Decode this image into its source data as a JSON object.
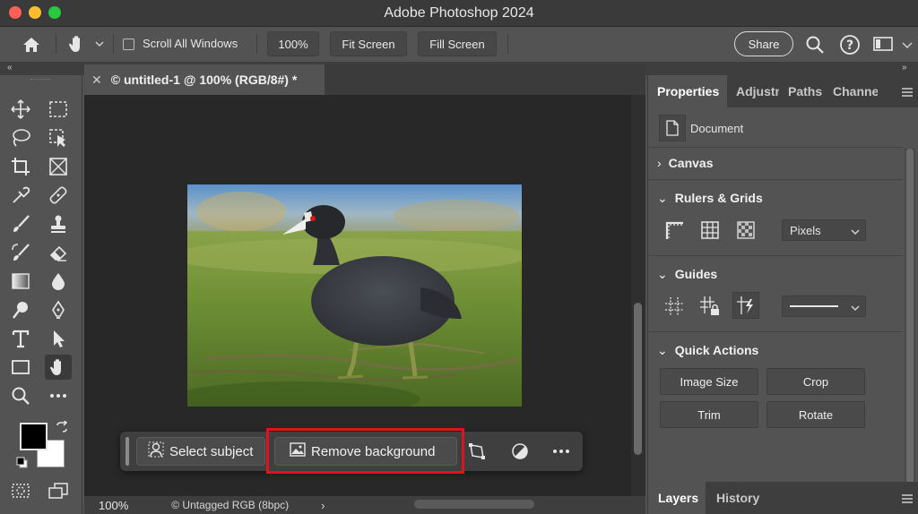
{
  "window": {
    "title": "Adobe Photoshop 2024"
  },
  "options": {
    "scroll_all_windows": "Scroll All Windows",
    "zoom": "100%",
    "fit_screen": "Fit Screen",
    "fill_screen": "Fill Screen",
    "share": "Share"
  },
  "document": {
    "tab_label": "© untitled-1 @ 100% (RGB/8#) *",
    "zoom_status": "100%",
    "color_profile": "© Untagged RGB (8bpc)"
  },
  "context_bar": {
    "select_subject": "Select subject",
    "remove_background": "Remove background"
  },
  "panel": {
    "tabs": [
      "Properties",
      "Adjustm",
      "Paths",
      "Channe"
    ],
    "document_label": "Document",
    "canvas": "Canvas",
    "rulers_grids": "Rulers & Grids",
    "units": "Pixels",
    "guides": "Guides",
    "quick_actions": "Quick Actions",
    "actions": [
      "Image Size",
      "Crop",
      "Trim",
      "Rotate"
    ],
    "bottom_tabs": [
      "Layers",
      "History"
    ]
  },
  "colors": {
    "highlight": "#e0121b",
    "foreground": "#000000",
    "background": "#ffffff"
  }
}
